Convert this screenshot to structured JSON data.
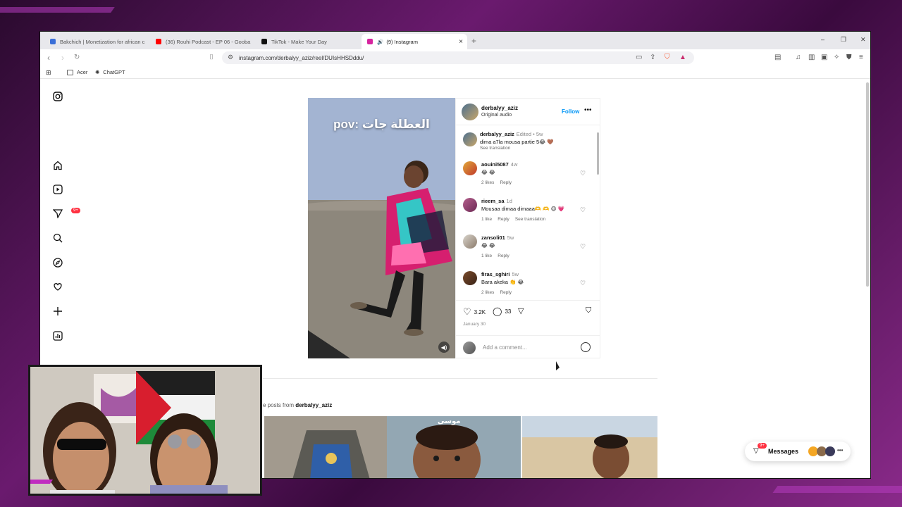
{
  "browser": {
    "tabs": [
      {
        "label": "Bakchich | Monetization for african c",
        "color": "#3b6fd8",
        "active": false
      },
      {
        "label": "(36) Rouhi Podcast - EP 06 - Gooba",
        "color": "#ff0000",
        "active": false
      },
      {
        "label": "TikTok - Make Your Day",
        "color": "#111111",
        "active": false
      },
      {
        "label": "(9) Instagram",
        "color": "#d6249f",
        "active": true
      }
    ],
    "url": "instagram.com/derbalyy_aziz/reel/DUIsHHSDddu/",
    "bookmarks": [
      "Acer",
      "ChatGPT"
    ]
  },
  "sidebar": {
    "notification_badge": "9+"
  },
  "reel": {
    "caption": "pov: العطلة جات"
  },
  "post": {
    "author": "derbalyy_aziz",
    "audio": "Original audio",
    "follow_label": "Follow",
    "caption": {
      "user": "derbalyy_aziz",
      "meta": "Edited • 5w",
      "text": "dima a7la mousa partie 5😂 🤎",
      "see_translation": "See translation"
    },
    "comments": [
      {
        "user": "aouini5087",
        "time": "4w",
        "text": "😂 😂",
        "likes": "2 likes",
        "reply": "Reply",
        "extra": ""
      },
      {
        "user": "rieem_sa",
        "time": "1d",
        "text": "Mousaa dimaa dimaaa🫶 🫶 😍 💗",
        "likes": "1 like",
        "reply": "Reply",
        "extra": "See translation"
      },
      {
        "user": "zansoli01",
        "time": "5w",
        "text": "😂 😂",
        "likes": "1 like",
        "reply": "Reply",
        "extra": ""
      },
      {
        "user": "firas_sghiri",
        "time": "5w",
        "text": "Bara akeka 👏 😂",
        "likes": "2 likes",
        "reply": "Reply",
        "extra": ""
      }
    ],
    "likes_count": "3.2K",
    "comments_count": "33",
    "date": "January 30",
    "add_comment_placeholder": "Add a comment..."
  },
  "more_posts": {
    "prefix": "e posts from",
    "user": "derbalyy_aziz",
    "thumb2_caption": "موسى"
  },
  "messages": {
    "label": "Messages",
    "badge": "9+"
  }
}
